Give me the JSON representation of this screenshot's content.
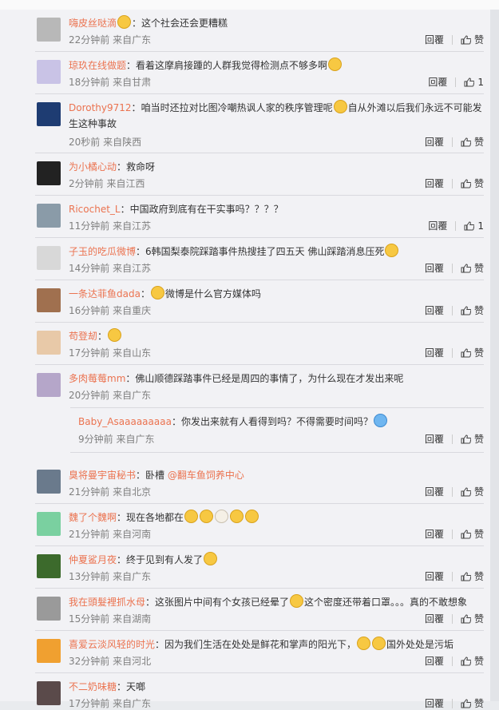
{
  "comments": [
    {
      "user": "嗨皮丝哒滴",
      "pre": "",
      "text": "这个社会还会更糟糕",
      "emojis": 1,
      "emoji_pos": "before",
      "time": "22分钟前",
      "loc": "来自广东",
      "like": "赞",
      "avatar": "#b8b8b8"
    },
    {
      "user": "琼玖在线做题",
      "pre": "",
      "text": "看着这摩肩接踵的人群我觉得检测点不够多啊",
      "emojis": 1,
      "emoji_pos": "after",
      "time": "18分钟前",
      "loc": "来自甘肃",
      "like": "1",
      "avatar": "#c9c3e6"
    },
    {
      "user": "Dorothy9712",
      "pre": "",
      "text": "咱当时还拉对比图冷嘲热讽人家的秩序管理呢",
      "text2": "自从外滩以后我们永远不可能发生这种事故",
      "emojis": 1,
      "emoji_pos": "middle",
      "time": "20秒前",
      "loc": "来自陕西",
      "like": "赞",
      "avatar": "#1e3c72"
    },
    {
      "user": "为小橘心动",
      "pre": "",
      "text": "救命呀",
      "emojis": 0,
      "time": "2分钟前",
      "loc": "来自江西",
      "like": "赞",
      "avatar": "#222222"
    },
    {
      "user": "Ricochet_L",
      "pre": "",
      "text": "中国政府到底有在干实事吗？？？？",
      "emojis": 0,
      "time": "11分钟前",
      "loc": "来自江苏",
      "like": "1",
      "avatar": "#8a9ba8"
    },
    {
      "user": "子玉的吃瓜微博",
      "pre": "",
      "text": "6韩国梨泰院踩踏事件热搜挂了四五天 佛山踩踏消息压死",
      "emojis": 1,
      "emoji_pos": "after",
      "time": "14分钟前",
      "loc": "来自江苏",
      "like": "赞",
      "avatar": "#d8d8d8"
    },
    {
      "user": "一条达菲鱼dada",
      "pre": "",
      "text": "微博是什么官方媒体吗",
      "emojis": 1,
      "emoji_pos": "before",
      "time": "16分钟前",
      "loc": "来自重庆",
      "like": "赞",
      "avatar": "#a0704f"
    },
    {
      "user": "苟登刼",
      "pre": "",
      "text": "",
      "emojis": 1,
      "emoji_pos": "only",
      "time": "17分钟前",
      "loc": "来自山东",
      "like": "赞",
      "avatar": "#e8c9a8"
    },
    {
      "user": "多肉莓莓mm",
      "pre": "",
      "text": "佛山顺德踩踏事件已经是周四的事情了，为什么现在才发出来呢",
      "emojis": 0,
      "time": "20分钟前",
      "loc": "来自广东",
      "like": "赞",
      "avatar": "#b5a6c9"
    }
  ],
  "reply": {
    "user": "Baby_Asaaaaaaaaa",
    "text": "你发出来就有人看得到吗？不得需要时间吗？",
    "time": "9分钟前",
    "loc": "来自广东",
    "like": "赞",
    "avatar": "none"
  },
  "comments2": [
    {
      "user": "臭将曼宇宙秘书",
      "text": "卧槽",
      "mention": "@翻车鱼饲养中心",
      "time": "21分钟前",
      "loc": "来自北京",
      "like": "赞",
      "avatar": "#6a7a8c"
    },
    {
      "user": "魏了个魏啊",
      "text": "现在各地都在",
      "emojis": 5,
      "time": "21分钟前",
      "loc": "来自河南",
      "like": "赞",
      "avatar": "#7ad0a0"
    },
    {
      "user": "仲夏鲨月夜",
      "text": "终于见到有人发了",
      "emojis": 1,
      "time": "13分钟前",
      "loc": "来自广东",
      "like": "赞",
      "avatar": "#3c6a2c"
    },
    {
      "user": "我在頭髮裡抓水母",
      "text": "这张图片中间有个女孩已经晕了",
      "text2": "这个密度还带着口罩。。。真的不敢想象",
      "emojis": 1,
      "time": "15分钟前",
      "loc": "来自湖南",
      "like": "赞",
      "avatar": "#9a9a9a"
    },
    {
      "user": "喜爱云淡风轻的时光",
      "text": "因为我们生活在处处是鲜花和掌声的阳光下，",
      "text2": "国外处处是污垢",
      "emojis": 2,
      "time": "32分钟前",
      "loc": "来自河北",
      "like": "赞",
      "avatar": "#f0a030"
    },
    {
      "user": "不二奶味糖",
      "text": "天啷",
      "emojis": 0,
      "time": "17分钟前",
      "loc": "来自广东",
      "like": "赞",
      "avatar": "#5a4a4a"
    }
  ],
  "labels": {
    "reply": "回覆",
    "colon": "："
  }
}
